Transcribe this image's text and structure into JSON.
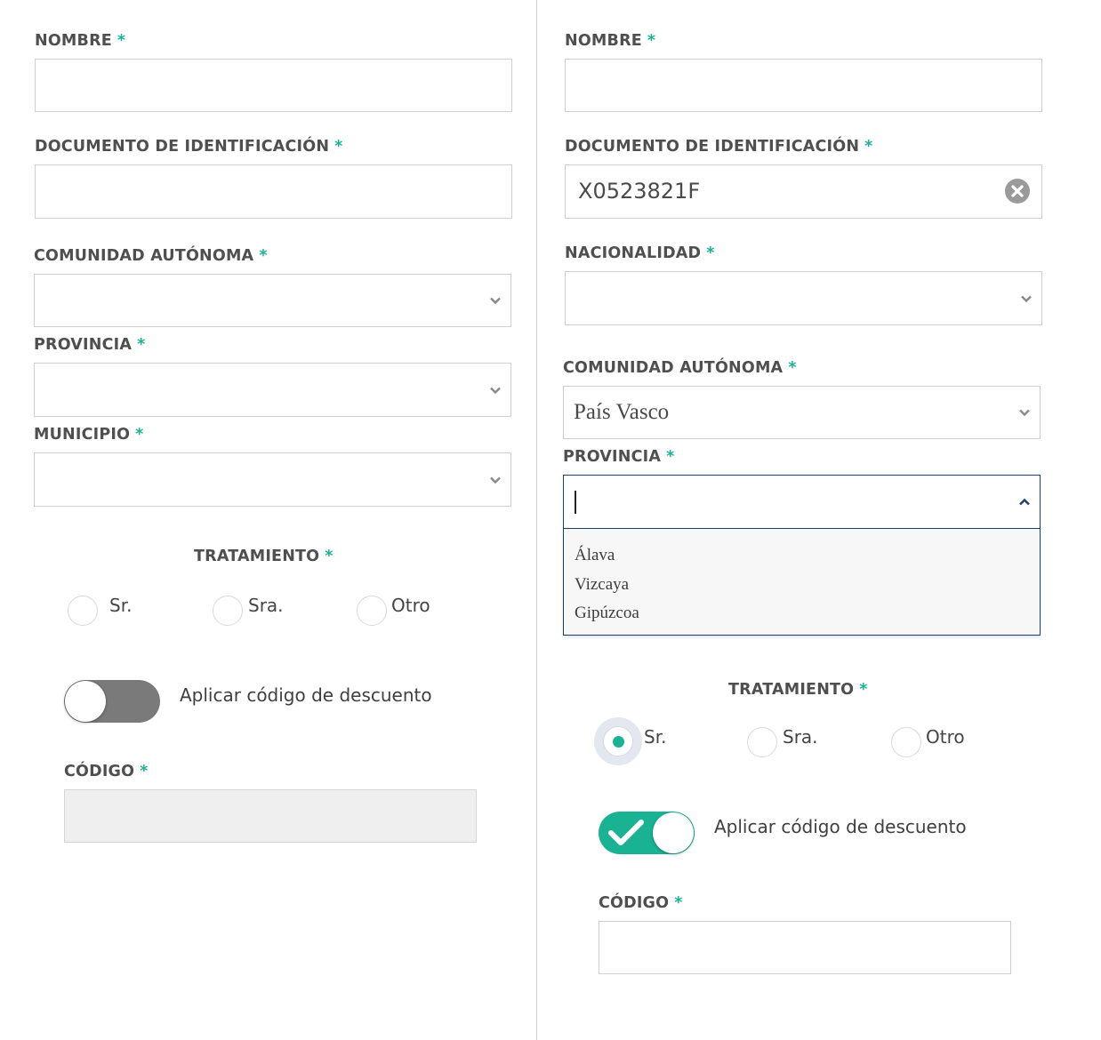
{
  "left": {
    "nombre_label": "NOMBRE",
    "documento_label": "DOCUMENTO DE IDENTIFICACIÓN",
    "comunidad_label": "COMUNIDAD AUTÓNOMA",
    "provincia_label": "PROVINCIA",
    "municipio_label": "MUNICIPIO",
    "tratamiento_label": "TRATAMIENTO",
    "radio_sr": "Sr.",
    "radio_sra": "Sra.",
    "radio_otro": "Otro",
    "toggle_label": "Aplicar código de descuento",
    "toggle_state": "off",
    "codigo_label": "CÓDIGO"
  },
  "right": {
    "nombre_label": "NOMBRE",
    "documento_label": "DOCUMENTO DE IDENTIFICACIÓN",
    "documento_value": "X0523821F",
    "nacionalidad_label": "NACIONALIDAD",
    "comunidad_label": "COMUNIDAD AUTÓNOMA",
    "comunidad_value": "País Vasco",
    "provincia_label": "PROVINCIA",
    "provincia_options": [
      "Álava",
      "Vizcaya",
      "Gipúzcoa"
    ],
    "tratamiento_label": "TRATAMIENTO",
    "radio_sr": "Sr.",
    "radio_sra": "Sra.",
    "radio_otro": "Otro",
    "radio_selected": "Sr.",
    "toggle_label": "Aplicar código de descuento",
    "toggle_state": "on",
    "codigo_label": "CÓDIGO"
  },
  "required_mark": "*",
  "colors": {
    "accent": "#19b394",
    "focus_border": "#1d3f6e",
    "toggle_off": "#7a7a7a",
    "label": "#4f4f4f"
  },
  "icons": {
    "select_arrow": "chevron-down-icon",
    "select_open_arrow": "chevron-up-icon",
    "clear": "clear-icon",
    "toggle_check": "check-icon"
  }
}
